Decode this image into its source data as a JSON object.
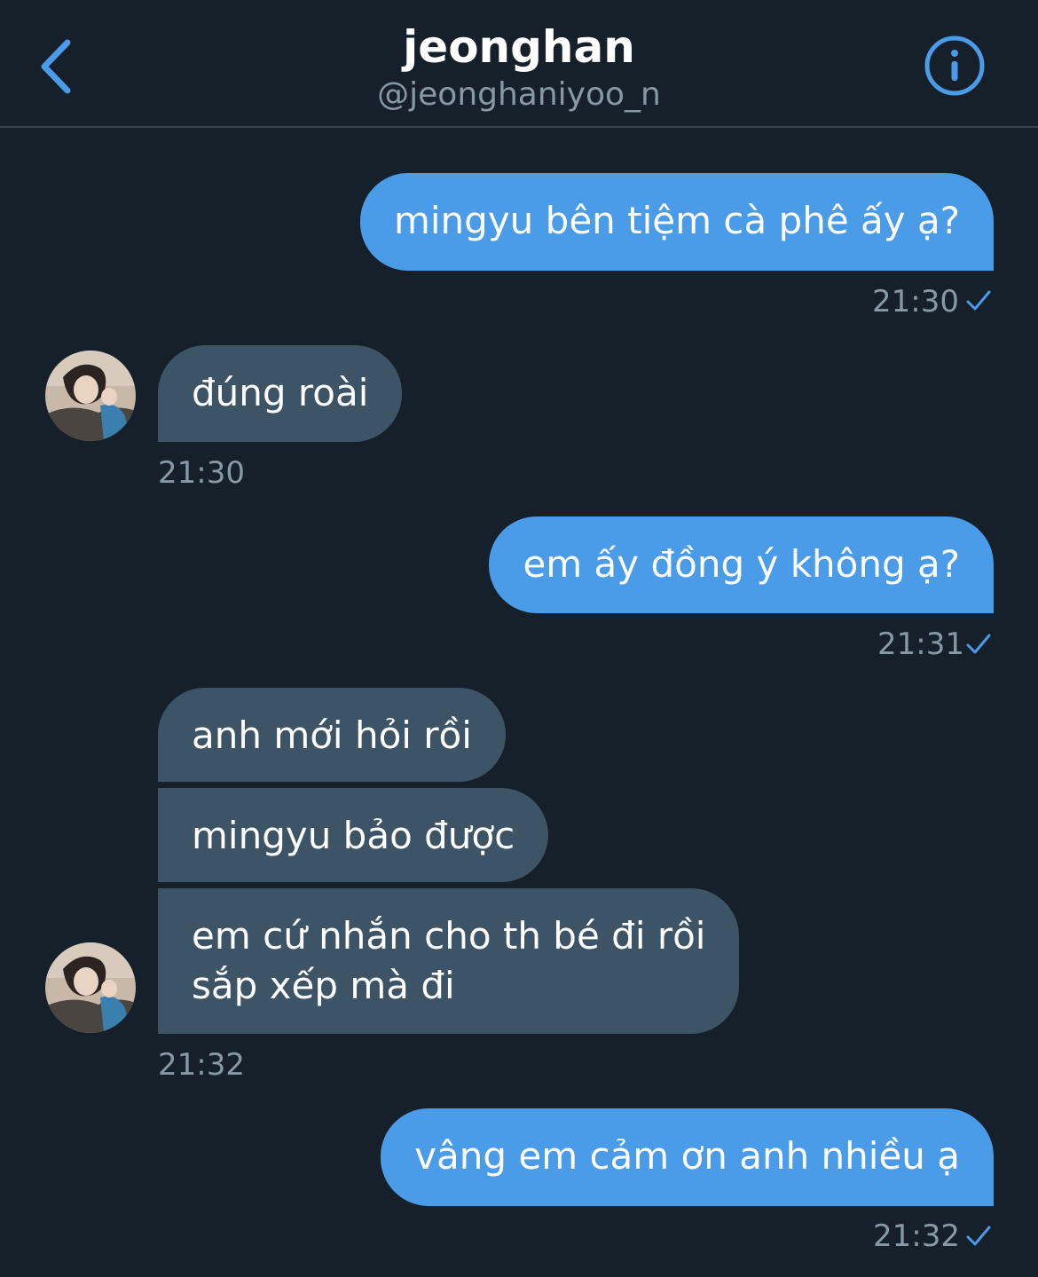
{
  "header": {
    "title": "jeonghan",
    "handle": "@jeonghaniyoo_n"
  },
  "messages": [
    {
      "dir": "out",
      "text": "mingyu bên tiệm cà phê ấy ạ?",
      "time": "21:30"
    },
    {
      "dir": "in",
      "text": "đúng roài",
      "time": "21:30"
    },
    {
      "dir": "out",
      "text": "em ấy đồng ý không ạ?",
      "time": "21:31"
    },
    {
      "dir": "in",
      "text": "anh mới hỏi rồi"
    },
    {
      "dir": "in",
      "text": "mingyu bảo được"
    },
    {
      "dir": "in",
      "text_line1": "em cứ nhắn cho th bé đi rồi",
      "text_line2": "sắp xếp mà đi",
      "time": "21:32"
    },
    {
      "dir": "out",
      "text": "vâng em cảm ơn anh nhiều ạ",
      "time": "21:32"
    }
  ],
  "icons": {
    "back": "chevron-left-icon",
    "info": "info-circle-icon",
    "read": "checkmark-icon"
  },
  "colors": {
    "background": "#15202b",
    "outgoing_bubble": "#4a9be8",
    "incoming_bubble": "#3d5466",
    "accent": "#4a9be8",
    "muted_text": "#8899a6"
  }
}
